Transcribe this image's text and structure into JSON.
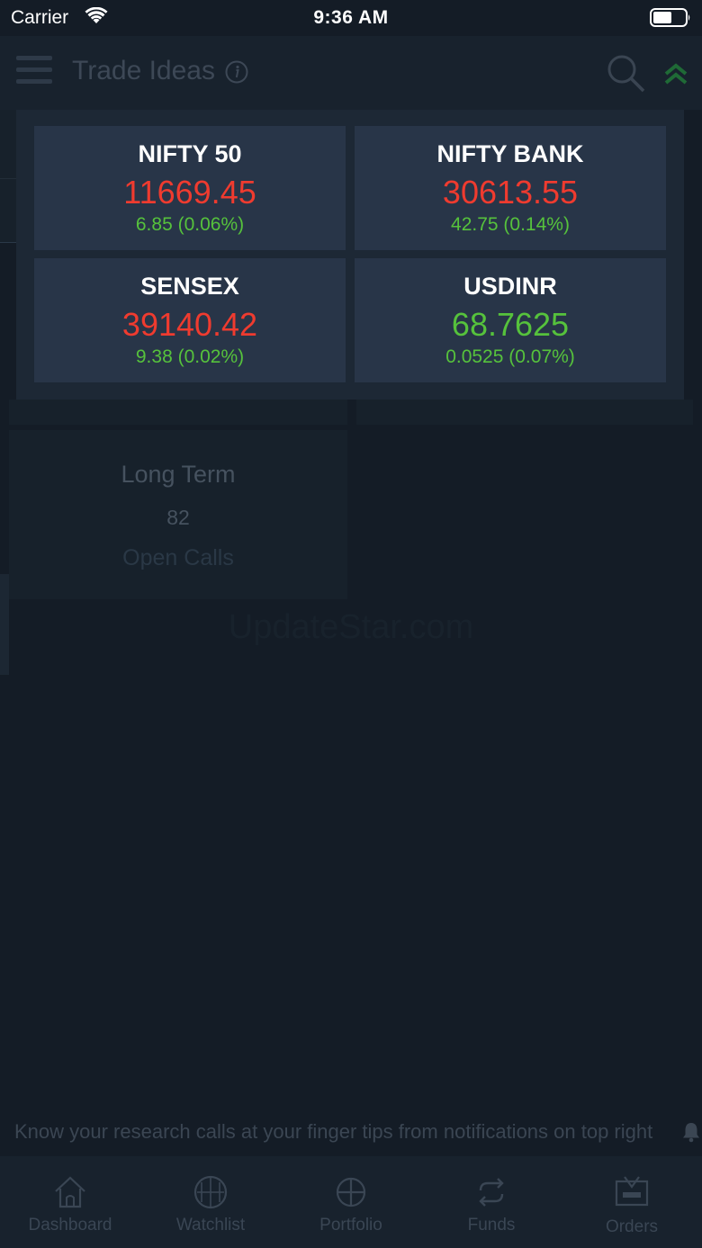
{
  "status_bar": {
    "carrier": "Carrier",
    "time": "9:36 AM",
    "wifi_icon": "wifi-icon",
    "battery_icon": "battery-icon"
  },
  "header": {
    "title": "Trade Ideas",
    "menu_icon": "hamburger-menu-icon",
    "info_icon": "info-icon",
    "search_icon": "search-icon",
    "collapse_icon": "double-chevron-up-icon"
  },
  "background_card": {
    "title": "Long Term",
    "count": "82",
    "subtitle": "Open Calls"
  },
  "watermark": "UpdateStar.com",
  "indices": [
    {
      "name": "NIFTY 50",
      "value": "11669.45",
      "change": "6.85 (0.06%)",
      "value_color": "red"
    },
    {
      "name": "NIFTY BANK",
      "value": "30613.55",
      "change": "42.75 (0.14%)",
      "value_color": "red"
    },
    {
      "name": "SENSEX",
      "value": "39140.42",
      "change": "9.38 (0.02%)",
      "value_color": "red"
    },
    {
      "name": "USDINR",
      "value": "68.7625",
      "change": "0.0525 (0.07%)",
      "value_color": "green"
    }
  ],
  "colors": {
    "negative": "#ef3b2f",
    "positive": "#56c23c",
    "tile_bg": "#283548",
    "popup_bg": "#1d2835",
    "page_bg": "#141c26"
  },
  "hint": {
    "text": "Know your research calls at your finger tips from notifications on top right",
    "icon": "bell-icon"
  },
  "tabs": [
    {
      "label": "Dashboard",
      "icon": "home-icon"
    },
    {
      "label": "Watchlist",
      "icon": "watchlist-icon"
    },
    {
      "label": "Portfolio",
      "icon": "portfolio-icon"
    },
    {
      "label": "Funds",
      "icon": "funds-icon"
    },
    {
      "label": "Orders",
      "icon": "orders-icon"
    }
  ]
}
